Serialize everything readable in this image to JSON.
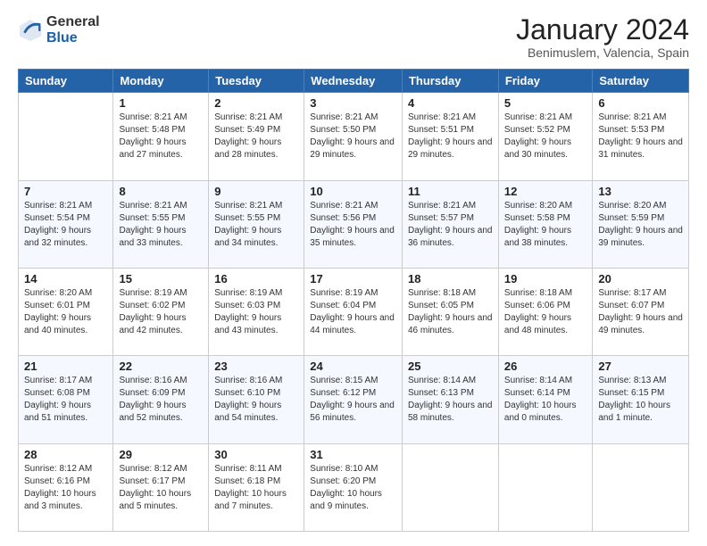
{
  "logo": {
    "general": "General",
    "blue": "Blue"
  },
  "header": {
    "month": "January 2024",
    "location": "Benimuslem, Valencia, Spain"
  },
  "days_of_week": [
    "Sunday",
    "Monday",
    "Tuesday",
    "Wednesday",
    "Thursday",
    "Friday",
    "Saturday"
  ],
  "weeks": [
    [
      {
        "day": "",
        "sunrise": "",
        "sunset": "",
        "daylight": ""
      },
      {
        "day": "1",
        "sunrise": "Sunrise: 8:21 AM",
        "sunset": "Sunset: 5:48 PM",
        "daylight": "Daylight: 9 hours and 27 minutes."
      },
      {
        "day": "2",
        "sunrise": "Sunrise: 8:21 AM",
        "sunset": "Sunset: 5:49 PM",
        "daylight": "Daylight: 9 hours and 28 minutes."
      },
      {
        "day": "3",
        "sunrise": "Sunrise: 8:21 AM",
        "sunset": "Sunset: 5:50 PM",
        "daylight": "Daylight: 9 hours and 29 minutes."
      },
      {
        "day": "4",
        "sunrise": "Sunrise: 8:21 AM",
        "sunset": "Sunset: 5:51 PM",
        "daylight": "Daylight: 9 hours and 29 minutes."
      },
      {
        "day": "5",
        "sunrise": "Sunrise: 8:21 AM",
        "sunset": "Sunset: 5:52 PM",
        "daylight": "Daylight: 9 hours and 30 minutes."
      },
      {
        "day": "6",
        "sunrise": "Sunrise: 8:21 AM",
        "sunset": "Sunset: 5:53 PM",
        "daylight": "Daylight: 9 hours and 31 minutes."
      }
    ],
    [
      {
        "day": "7",
        "sunrise": "Sunrise: 8:21 AM",
        "sunset": "Sunset: 5:54 PM",
        "daylight": "Daylight: 9 hours and 32 minutes."
      },
      {
        "day": "8",
        "sunrise": "Sunrise: 8:21 AM",
        "sunset": "Sunset: 5:55 PM",
        "daylight": "Daylight: 9 hours and 33 minutes."
      },
      {
        "day": "9",
        "sunrise": "Sunrise: 8:21 AM",
        "sunset": "Sunset: 5:55 PM",
        "daylight": "Daylight: 9 hours and 34 minutes."
      },
      {
        "day": "10",
        "sunrise": "Sunrise: 8:21 AM",
        "sunset": "Sunset: 5:56 PM",
        "daylight": "Daylight: 9 hours and 35 minutes."
      },
      {
        "day": "11",
        "sunrise": "Sunrise: 8:21 AM",
        "sunset": "Sunset: 5:57 PM",
        "daylight": "Daylight: 9 hours and 36 minutes."
      },
      {
        "day": "12",
        "sunrise": "Sunrise: 8:20 AM",
        "sunset": "Sunset: 5:58 PM",
        "daylight": "Daylight: 9 hours and 38 minutes."
      },
      {
        "day": "13",
        "sunrise": "Sunrise: 8:20 AM",
        "sunset": "Sunset: 5:59 PM",
        "daylight": "Daylight: 9 hours and 39 minutes."
      }
    ],
    [
      {
        "day": "14",
        "sunrise": "Sunrise: 8:20 AM",
        "sunset": "Sunset: 6:01 PM",
        "daylight": "Daylight: 9 hours and 40 minutes."
      },
      {
        "day": "15",
        "sunrise": "Sunrise: 8:19 AM",
        "sunset": "Sunset: 6:02 PM",
        "daylight": "Daylight: 9 hours and 42 minutes."
      },
      {
        "day": "16",
        "sunrise": "Sunrise: 8:19 AM",
        "sunset": "Sunset: 6:03 PM",
        "daylight": "Daylight: 9 hours and 43 minutes."
      },
      {
        "day": "17",
        "sunrise": "Sunrise: 8:19 AM",
        "sunset": "Sunset: 6:04 PM",
        "daylight": "Daylight: 9 hours and 44 minutes."
      },
      {
        "day": "18",
        "sunrise": "Sunrise: 8:18 AM",
        "sunset": "Sunset: 6:05 PM",
        "daylight": "Daylight: 9 hours and 46 minutes."
      },
      {
        "day": "19",
        "sunrise": "Sunrise: 8:18 AM",
        "sunset": "Sunset: 6:06 PM",
        "daylight": "Daylight: 9 hours and 48 minutes."
      },
      {
        "day": "20",
        "sunrise": "Sunrise: 8:17 AM",
        "sunset": "Sunset: 6:07 PM",
        "daylight": "Daylight: 9 hours and 49 minutes."
      }
    ],
    [
      {
        "day": "21",
        "sunrise": "Sunrise: 8:17 AM",
        "sunset": "Sunset: 6:08 PM",
        "daylight": "Daylight: 9 hours and 51 minutes."
      },
      {
        "day": "22",
        "sunrise": "Sunrise: 8:16 AM",
        "sunset": "Sunset: 6:09 PM",
        "daylight": "Daylight: 9 hours and 52 minutes."
      },
      {
        "day": "23",
        "sunrise": "Sunrise: 8:16 AM",
        "sunset": "Sunset: 6:10 PM",
        "daylight": "Daylight: 9 hours and 54 minutes."
      },
      {
        "day": "24",
        "sunrise": "Sunrise: 8:15 AM",
        "sunset": "Sunset: 6:12 PM",
        "daylight": "Daylight: 9 hours and 56 minutes."
      },
      {
        "day": "25",
        "sunrise": "Sunrise: 8:14 AM",
        "sunset": "Sunset: 6:13 PM",
        "daylight": "Daylight: 9 hours and 58 minutes."
      },
      {
        "day": "26",
        "sunrise": "Sunrise: 8:14 AM",
        "sunset": "Sunset: 6:14 PM",
        "daylight": "Daylight: 10 hours and 0 minutes."
      },
      {
        "day": "27",
        "sunrise": "Sunrise: 8:13 AM",
        "sunset": "Sunset: 6:15 PM",
        "daylight": "Daylight: 10 hours and 1 minute."
      }
    ],
    [
      {
        "day": "28",
        "sunrise": "Sunrise: 8:12 AM",
        "sunset": "Sunset: 6:16 PM",
        "daylight": "Daylight: 10 hours and 3 minutes."
      },
      {
        "day": "29",
        "sunrise": "Sunrise: 8:12 AM",
        "sunset": "Sunset: 6:17 PM",
        "daylight": "Daylight: 10 hours and 5 minutes."
      },
      {
        "day": "30",
        "sunrise": "Sunrise: 8:11 AM",
        "sunset": "Sunset: 6:18 PM",
        "daylight": "Daylight: 10 hours and 7 minutes."
      },
      {
        "day": "31",
        "sunrise": "Sunrise: 8:10 AM",
        "sunset": "Sunset: 6:20 PM",
        "daylight": "Daylight: 10 hours and 9 minutes."
      },
      {
        "day": "",
        "sunrise": "",
        "sunset": "",
        "daylight": ""
      },
      {
        "day": "",
        "sunrise": "",
        "sunset": "",
        "daylight": ""
      },
      {
        "day": "",
        "sunrise": "",
        "sunset": "",
        "daylight": ""
      }
    ]
  ]
}
